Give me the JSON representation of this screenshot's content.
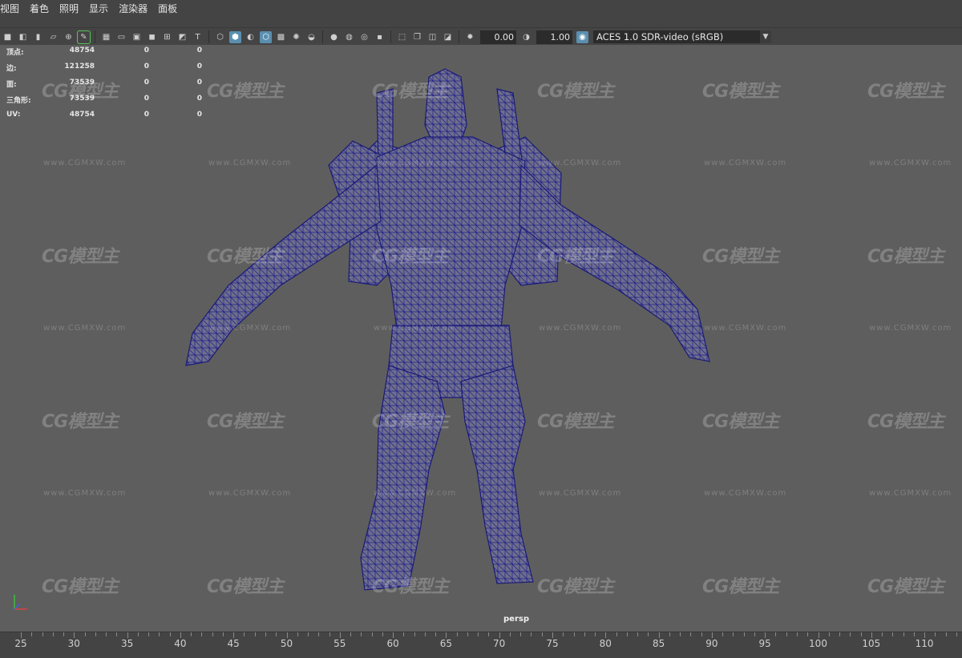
{
  "menu": [
    "视图",
    "着色",
    "照明",
    "显示",
    "渲染器",
    "面板"
  ],
  "toolbar": {
    "exposure_value": "0.00",
    "gamma_value": "1.00",
    "color_space": "ACES 1.0 SDR-video (sRGB)"
  },
  "hud": [
    {
      "label": "顶点:",
      "v1": "48754",
      "v2": "0",
      "v3": "0"
    },
    {
      "label": "边:",
      "v1": "121258",
      "v2": "0",
      "v3": "0"
    },
    {
      "label": "面:",
      "v1": "73539",
      "v2": "0",
      "v3": "0"
    },
    {
      "label": "三角形:",
      "v1": "73539",
      "v2": "0",
      "v3": "0"
    },
    {
      "label": "UV:",
      "v1": "48754",
      "v2": "0",
      "v3": "0"
    }
  ],
  "watermark": {
    "logo": "CG模型主",
    "url": "www.CGMXW.com"
  },
  "camera_label": "persp",
  "timeline_ticks": [
    "25",
    "30",
    "35",
    "40",
    "45",
    "50",
    "55",
    "60",
    "65",
    "70",
    "75",
    "80",
    "85",
    "90",
    "95",
    "100",
    "105",
    "110"
  ],
  "colors": {
    "wireframe": "#1f1f8a",
    "viewport_bg": "#5e5e5e",
    "active_tool": "#5a8fb0"
  }
}
